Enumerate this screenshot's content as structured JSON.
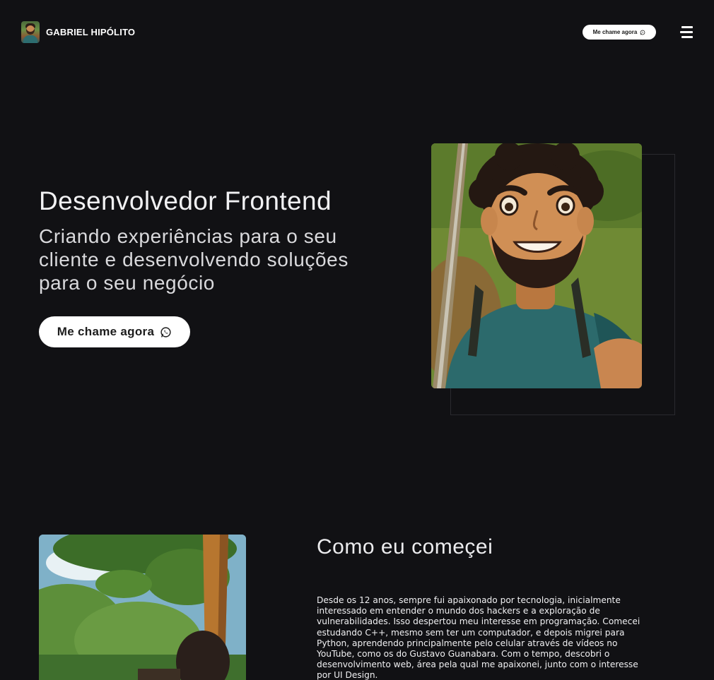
{
  "header": {
    "brand_name": "GABRIEL HIPÓLITO",
    "cta_label": "Me chame agora",
    "menu_icon": "hamburger-icon"
  },
  "hero": {
    "title": "Desenvolvedor Frontend",
    "subtitle": "Criando experiências para o seu cliente e desenvolvendo soluções para o seu negócio",
    "cta_label": "Me chame agora",
    "cta_icon": "whatsapp-icon"
  },
  "about": {
    "title": "Como eu começei",
    "paragraph": "Desde os 12 anos, sempre fui apaixonado por tecnologia, inicialmente interessado em entender o mundo dos hackers e a exploração de vulnerabilidades. Isso despertou meu interesse em programação. Comecei estudando C++, mesmo sem ter um computador, e depois migrei para Python, aprendendo principalmente pelo celular através de vídeos no YouTube, como os do Gustavo Guanabara. Com o tempo, descobri o desenvolvimento web, área pela qual me apaixonei, junto com o interesse por UI Design."
  },
  "colors": {
    "background": "#111114",
    "button_bg": "#ffffff",
    "button_text": "#1c1c1c",
    "text": "#e8e8ea"
  }
}
